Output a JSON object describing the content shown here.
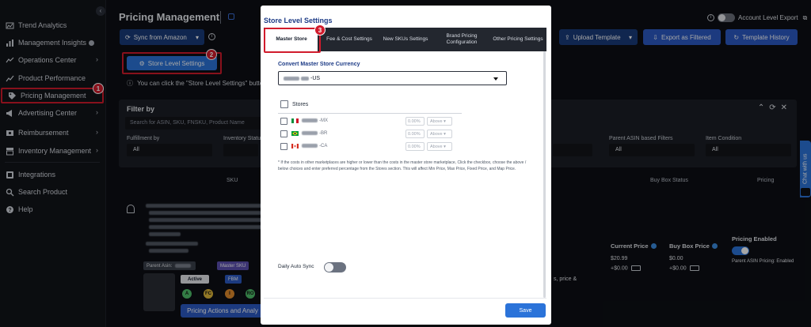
{
  "sidebar": {
    "items": [
      {
        "label": "Trend Analytics",
        "icon": "trend-analytics-icon"
      },
      {
        "label": "Management Insights",
        "icon": "insights-icon",
        "info": true
      },
      {
        "label": "Operations Center",
        "icon": "operations-icon",
        "chevron": true
      },
      {
        "label": "Product Performance",
        "icon": "product-performance-icon"
      },
      {
        "label": "Pricing Management",
        "icon": "price-tag-icon",
        "active": true
      },
      {
        "label": "Advertising Center",
        "icon": "advertising-icon",
        "chevron": true
      },
      {
        "label": "Reimbursement",
        "icon": "reimbursement-icon",
        "chevron": true
      },
      {
        "label": "Inventory Management",
        "icon": "inventory-icon",
        "chevron": true
      }
    ],
    "bottom_items": [
      {
        "label": "Integrations",
        "icon": "integrations-icon"
      },
      {
        "label": "Search Product",
        "icon": "search-icon"
      },
      {
        "label": "Help",
        "icon": "help-icon"
      }
    ],
    "collapse_glyph": "‹"
  },
  "steps": {
    "one": "1",
    "two": "2",
    "three": "3"
  },
  "header": {
    "title": "Pricing Management",
    "sync_button": "Sync from Amazon",
    "account_export": "Account Level Export",
    "upload_template": "Upload Template",
    "export_filtered": "Export as Filtered",
    "template_history": "Template History"
  },
  "store_level_button": "Store Level Settings",
  "notice": "You can click the \"Store Level Settings\" button to",
  "filter": {
    "title": "Filter by",
    "search_placeholder": "Search for ASIN, SKU, FNSKU, Product Name",
    "fields": [
      {
        "label": "Fulfillment by",
        "value": "All"
      },
      {
        "label": "Inventory Status",
        "value": ""
      },
      {
        "label": "Parent ASIN based Filters",
        "value": "All"
      },
      {
        "label": "Item Condition",
        "value": "All"
      }
    ]
  },
  "table": {
    "headers": {
      "sku": "SKU",
      "buy_box_status": "Buy Box Status",
      "pricing": "Pricing"
    }
  },
  "row": {
    "parent_asin_label": "Parent Asin:",
    "master_sku": "Master SKU",
    "status": "Active",
    "fulfillment": "FBM",
    "dots": [
      {
        "label": "A",
        "color": "#4fbf6b"
      },
      {
        "label": "FC",
        "color": "#e0b83b"
      },
      {
        "label": "I",
        "color": "#e08a2b"
      },
      {
        "label": "RO",
        "color": "#4fbf6b"
      }
    ],
    "action_button": "Pricing Actions and Analy",
    "trailing_text": "s, price &",
    "current_price_label": "Current Price",
    "current_price": "$20.99",
    "current_shipping": "+$0.00",
    "buy_box_price_label": "Buy Box Price",
    "buy_box_price": "$0.00",
    "buy_box_shipping": "+$0.00",
    "pricing_enabled_label": "Pricing Enabled",
    "parent_asin_pricing": "Parent ASIN Pricing: Enabled"
  },
  "chat_tab": "Chat with us",
  "modal": {
    "title": "Store Level Settings",
    "tabs": [
      {
        "label": "Master Store",
        "active": true
      },
      {
        "label": "Fee & Cost Settings"
      },
      {
        "label": "New SKUs Settings"
      },
      {
        "label": "Brand Pricing Configuration"
      },
      {
        "label": "Other Pricing Settings"
      }
    ],
    "convert_label": "Convert Master Store Currency",
    "currency_suffix": "-US",
    "stores_header": "Stores",
    "stores": [
      {
        "suffix": "-MX",
        "pct": "0.00%",
        "dir": "Above"
      },
      {
        "suffix": "-BR",
        "pct": "0.00%",
        "dir": "Above"
      },
      {
        "suffix": "-CA",
        "pct": "0.00%",
        "dir": "Above"
      }
    ],
    "footnote": "* If the costs in other marketplaces are higher or lower than the costs in the master store marketplace, Click the checkbox, choose the above / below choices and enter preferred percentage from the Stores section. This will affect Min Price, Max Price, Fixed Price, and Map Price.",
    "daily_auto_sync": "Daily Auto Sync",
    "save_button": "Save"
  }
}
